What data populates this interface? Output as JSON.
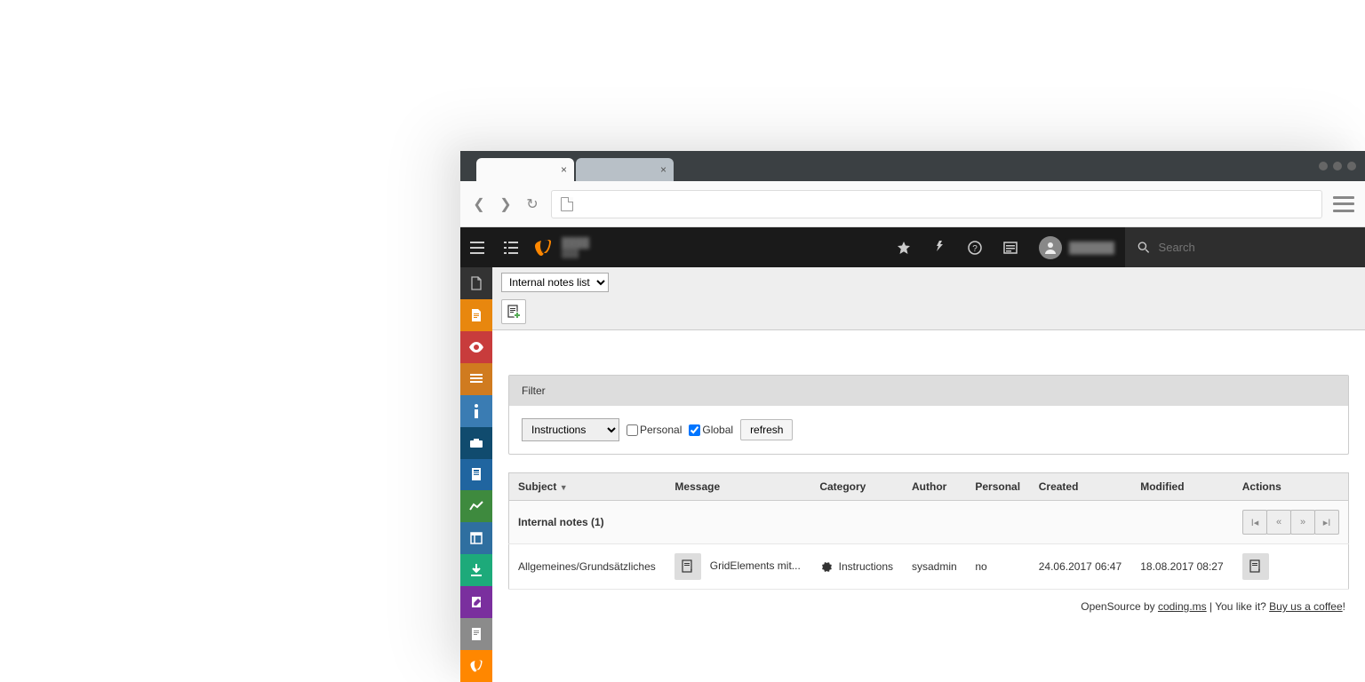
{
  "search_placeholder": "Search",
  "module_dropdown": "Internal notes list",
  "filter": {
    "title": "Filter",
    "category_selected": "Instructions",
    "personal_label": "Personal",
    "global_label": "Global",
    "refresh": "refresh"
  },
  "table": {
    "headers": {
      "subject": "Subject",
      "message": "Message",
      "category": "Category",
      "author": "Author",
      "personal": "Personal",
      "created": "Created",
      "modified": "Modified",
      "actions": "Actions"
    },
    "group_title": "Internal notes (1)",
    "rows": [
      {
        "subject": "Allgemeines/Grundsätzliches",
        "message": "GridElements mit...",
        "category": "Instructions",
        "author": "sysadmin",
        "personal": "no",
        "created": "24.06.2017 06:47",
        "modified": "18.08.2017 08:27"
      }
    ]
  },
  "footer": {
    "prefix": "OpenSource by ",
    "link1": "coding.ms",
    "mid": " | You like it? ",
    "link2": "Buy us a coffee",
    "suffix": "!"
  }
}
